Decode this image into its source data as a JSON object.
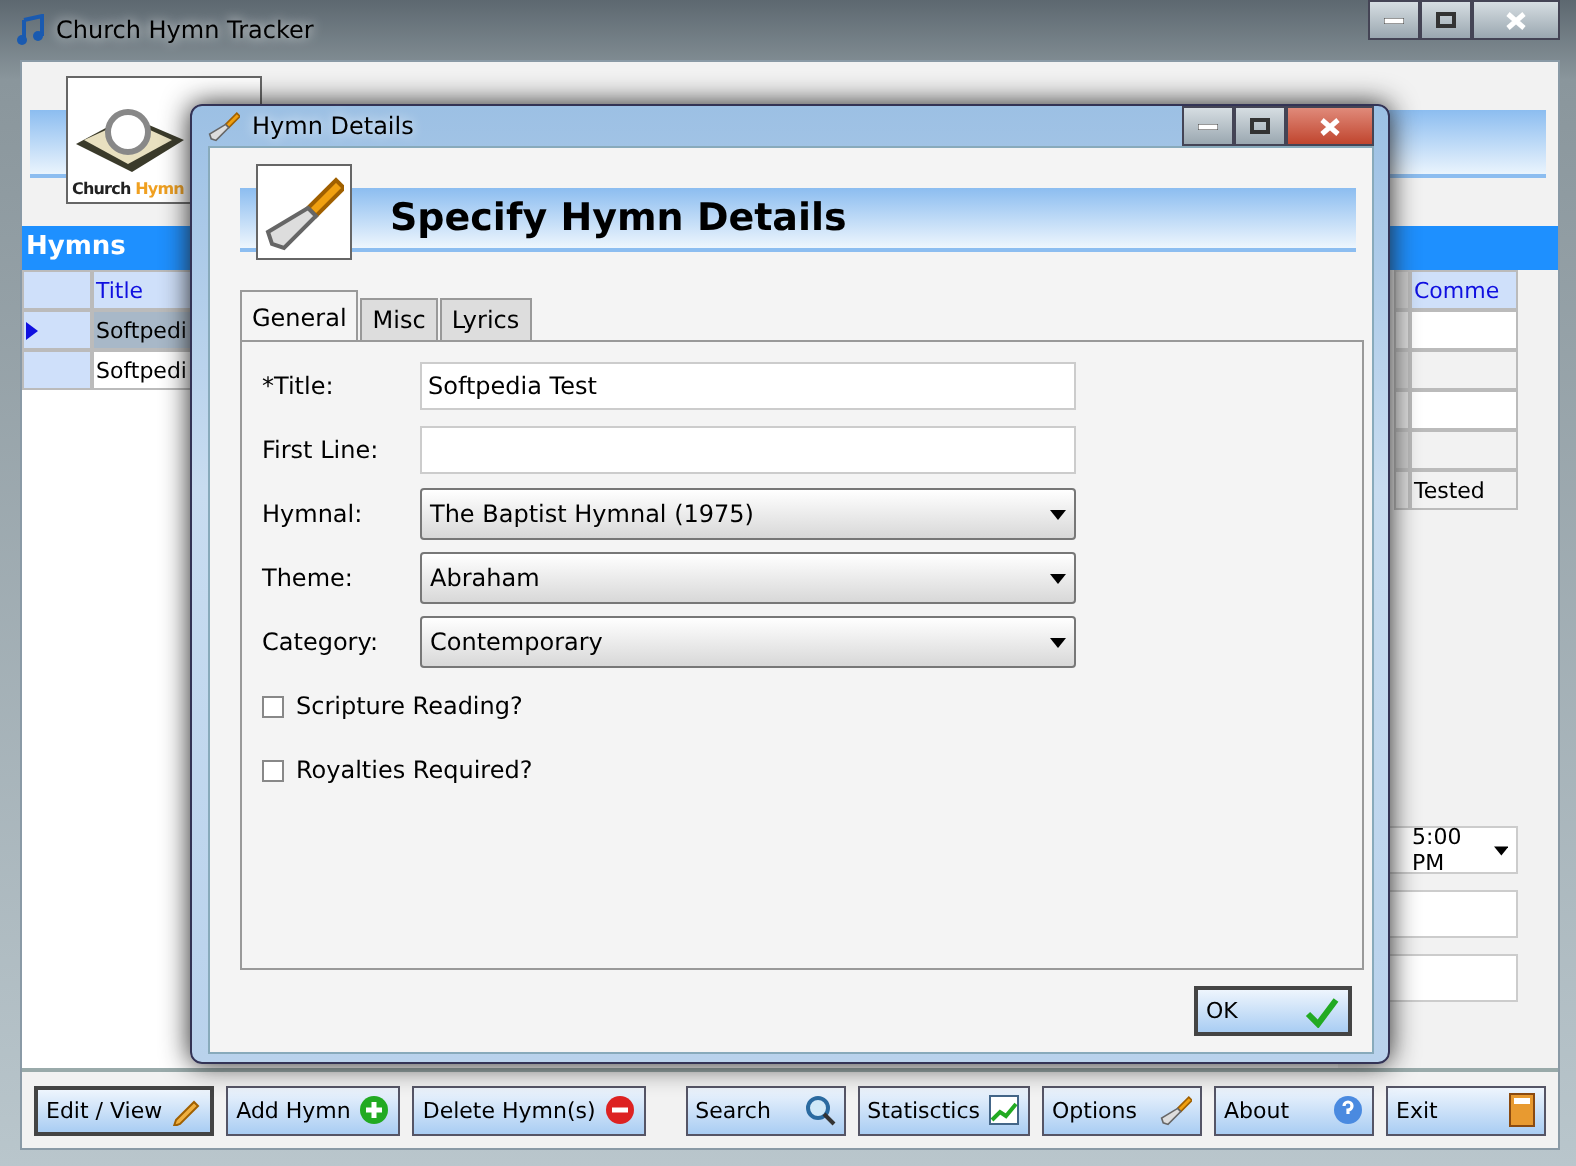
{
  "window": {
    "title": "Church Hymn Tracker"
  },
  "logo": {
    "text_plain": "Church",
    "text_accent": "Hymn"
  },
  "hymns_bar": {
    "title": "Hymns"
  },
  "grid": {
    "column": "Title",
    "rows": [
      {
        "title": "Softpedi",
        "selected": true
      },
      {
        "title": "Softpedi",
        "selected": false
      }
    ],
    "right_column": "Comme",
    "right_last_cell": "Tested"
  },
  "side_fields": {
    "time": "5:00 PM"
  },
  "dialog": {
    "title": "Hymn Details",
    "heading": "Specify Hymn Details",
    "tabs": [
      {
        "label": "General",
        "selected": true
      },
      {
        "label": "Misc",
        "selected": false
      },
      {
        "label": "Lyrics",
        "selected": false
      }
    ],
    "fields": [
      {
        "kind": "text",
        "label": "*Title:",
        "value": "Softpedia Test"
      },
      {
        "kind": "text",
        "label": "First Line:"
      },
      {
        "kind": "select",
        "label": "Hymnal:",
        "value": "The Baptist Hymnal (1975)"
      },
      {
        "kind": "select",
        "label": "Theme:",
        "value": "Abraham"
      },
      {
        "kind": "select",
        "label": "Category:",
        "value": "Contemporary"
      }
    ],
    "checkboxes": [
      {
        "label": "Scripture Reading?",
        "checked": false
      },
      {
        "label": "Royalties Required?",
        "checked": false
      }
    ],
    "ok": "OK"
  },
  "buttons_left": [
    {
      "label": "Edit / View",
      "focused": true
    },
    {
      "label": "Add Hymn",
      "focused": false
    },
    {
      "label": "Delete Hymn(s)",
      "focused": false
    }
  ],
  "buttons_right": [
    {
      "label": "Search",
      "focused": false
    },
    {
      "label": "Statisctics",
      "focused": false
    },
    {
      "label": "Options",
      "focused": false
    },
    {
      "label": "About",
      "focused": false
    },
    {
      "label": "Exit",
      "focused": false
    }
  ]
}
